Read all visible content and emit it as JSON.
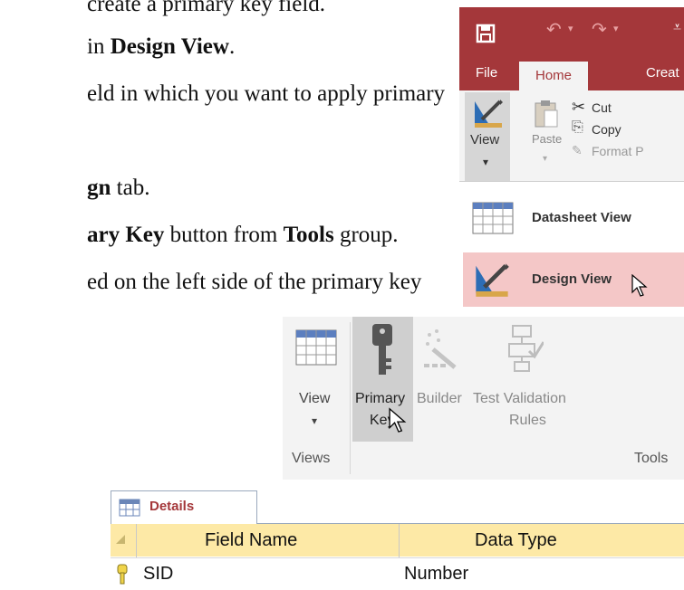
{
  "document": {
    "line1": {
      "text": "create a primary key field."
    },
    "line2": {
      "pre": "in ",
      "bold": "Design View",
      "post": "."
    },
    "line3": {
      "text": "eld in which you want to apply primary"
    },
    "line4": {
      "bold": "gn",
      "post": " tab."
    },
    "line5": {
      "bold1": "ary Key",
      "mid": " button from ",
      "bold2": "Tools",
      "post": " group."
    },
    "line6": {
      "text": "ed on the left side of the primary key"
    }
  },
  "ribbon_top": {
    "tabs": [
      {
        "label": "File"
      },
      {
        "label": "Home"
      },
      {
        "label": "Creat"
      }
    ],
    "view_button": {
      "label": "View",
      "dropdown": "▾"
    },
    "clipboard": {
      "paste_label": "Paste",
      "cut_label": "Cut",
      "copy_label": "Copy",
      "format_label": "Format P"
    },
    "view_menu": [
      {
        "label": "Datasheet View",
        "icon": "datasheet-icon"
      },
      {
        "label": "Design View",
        "icon": "design-view-icon"
      }
    ],
    "colors": {
      "title_bar": "#a4373a",
      "ribbon_bg": "#f3f3f3",
      "highlight": "#f4c7c7"
    }
  },
  "ribbon_design": {
    "views_group": {
      "view_label": "View",
      "dropdown": "▾",
      "group_label": "Views"
    },
    "tools_group": {
      "primary_key": {
        "line1": "Primary",
        "line2": "Key"
      },
      "builder": {
        "label": "Builder"
      },
      "test_validation": {
        "line1": "Test Validation",
        "line2": "Rules"
      },
      "group_label": "Tools"
    }
  },
  "table_design": {
    "tab_label": "Details",
    "columns": [
      "Field Name",
      "Data Type"
    ],
    "rows": [
      {
        "field_name": "SID",
        "data_type": "Number",
        "primary_key": true
      }
    ],
    "colors": {
      "header_bg": "#fde9a6",
      "tab_label": "#a4373a"
    }
  }
}
